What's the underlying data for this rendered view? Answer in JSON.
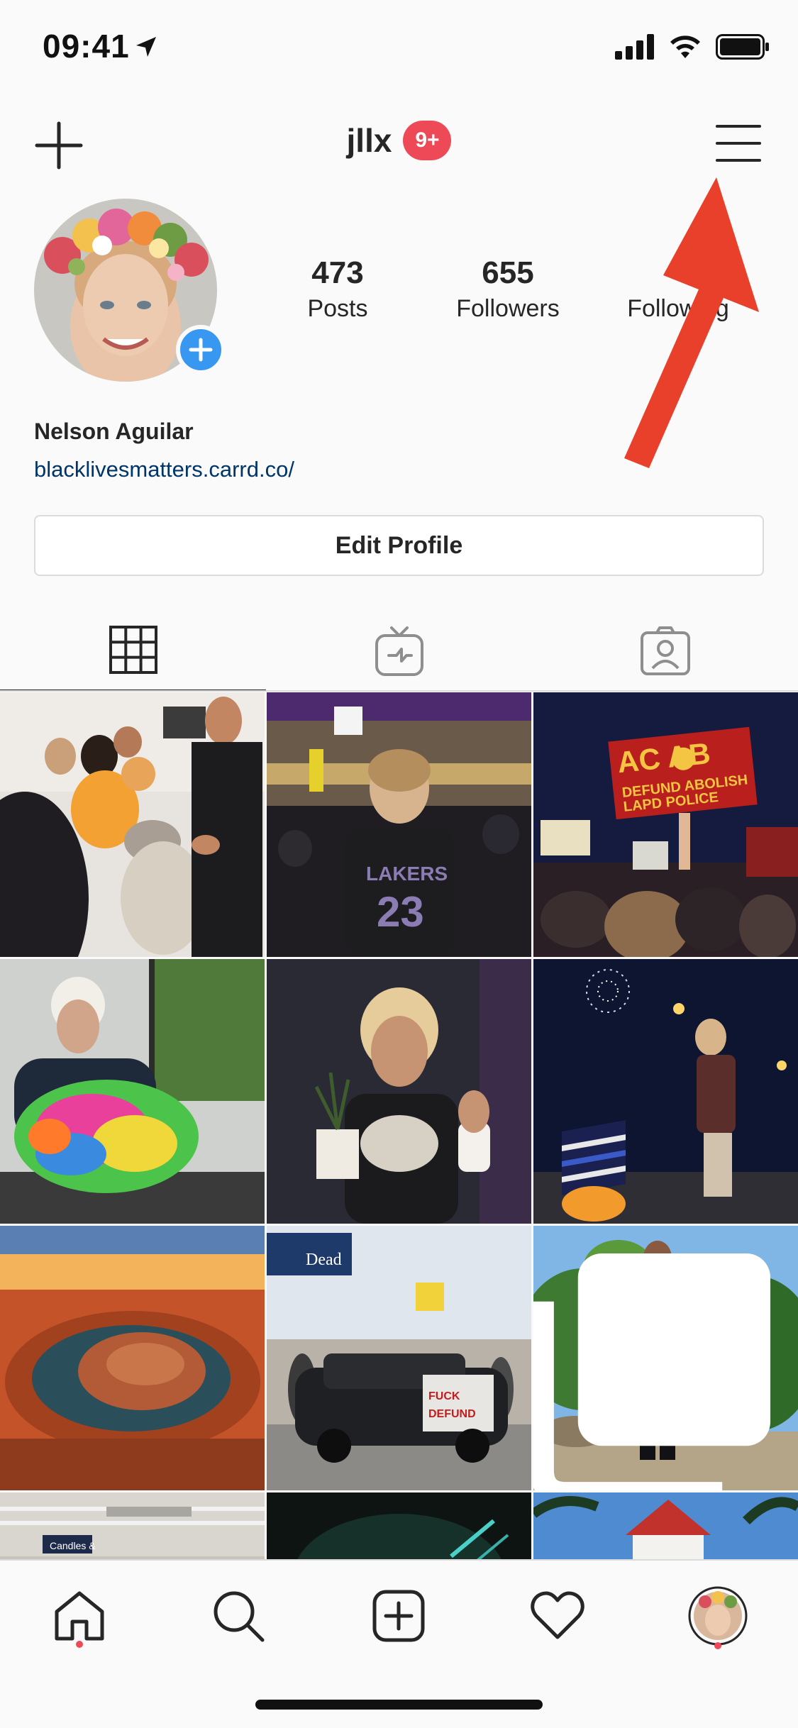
{
  "status_bar": {
    "time": "09:41",
    "icons": [
      "location-arrow-icon",
      "cellular-signal-icon",
      "wifi-icon",
      "battery-icon"
    ]
  },
  "top_nav": {
    "username": "jllx",
    "notification_badge": "9+",
    "icons": [
      "new-post-plus-icon",
      "hamburger-menu-icon"
    ]
  },
  "profile": {
    "posts_count": "473",
    "posts_label": "Posts",
    "followers_count": "655",
    "followers_label": "Followers",
    "following_label": "Following",
    "name": "Nelson Aguilar",
    "link": "blacklivesmatters.carrd.co/",
    "edit_button": "Edit Profile"
  },
  "tabs": [
    {
      "icon": "grid-icon",
      "active": true
    },
    {
      "icon": "igtv-icon",
      "active": false
    },
    {
      "icon": "tagged-person-icon",
      "active": false
    }
  ],
  "grid": {
    "posts": [
      {
        "subject": "family-gathering",
        "multi": false
      },
      {
        "subject": "lakers-game",
        "multi": false
      },
      {
        "subject": "protest-acab-sign",
        "multi": false
      },
      {
        "subject": "colorful-bag",
        "multi": false
      },
      {
        "subject": "plant-selfie",
        "multi": false
      },
      {
        "subject": "fireworks-flag",
        "multi": false
      },
      {
        "subject": "horseshoe-bend",
        "multi": false
      },
      {
        "subject": "police-car-graffiti",
        "multi": false
      },
      {
        "subject": "palm-trees-portrait",
        "multi": true
      },
      {
        "subject": "store-aisle",
        "multi": false
      },
      {
        "subject": "dark-green",
        "multi": false
      },
      {
        "subject": "hotel-del-coronado",
        "multi": false
      }
    ],
    "store_sign_text": "Candles &",
    "protest_sign_text": "ACAB DEFUND LAPD ABOLISH POLICE"
  },
  "bottom_bar": {
    "icons": [
      "home-icon",
      "search-icon",
      "new-post-icon",
      "activity-heart-icon",
      "profile-avatar-icon"
    ]
  },
  "colors": {
    "accent_blue": "#3897f0",
    "badge_red": "#ed4956",
    "link_blue": "#003569",
    "arrow_red": "#e8402b",
    "text": "#262626"
  }
}
